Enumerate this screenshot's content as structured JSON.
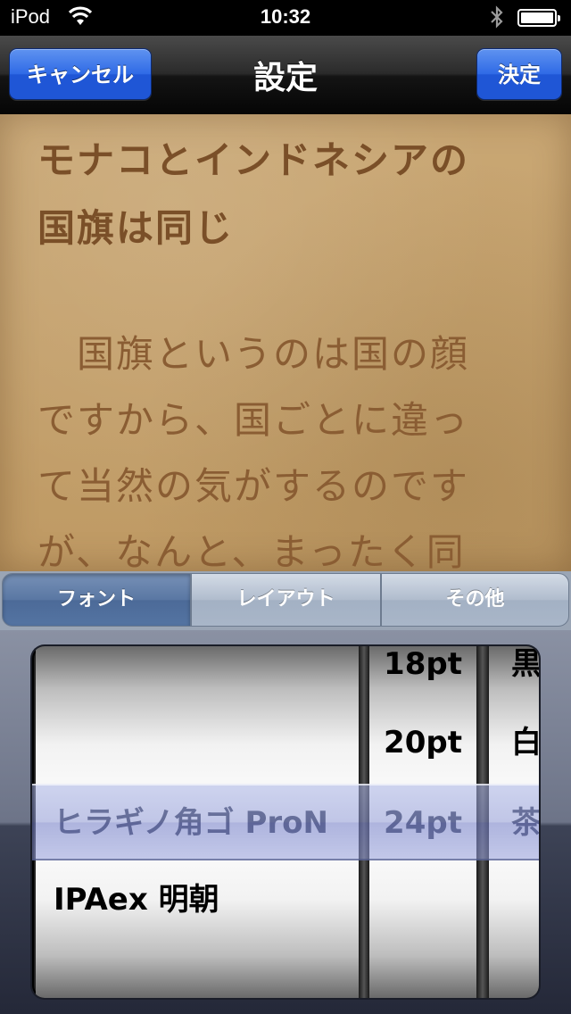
{
  "status": {
    "carrier": "iPod",
    "time": "10:32"
  },
  "nav": {
    "cancel_label": "キャンセル",
    "title": "設定",
    "done_label": "決定"
  },
  "preview": {
    "heading": [
      "モナコとインドネシアの",
      "国旗は同じ"
    ],
    "body": [
      "　国旗というのは国の顔",
      "ですから、国ごとに違っ",
      "て当然の気がするのです",
      "が、なんと、まったく同"
    ]
  },
  "tabs": [
    {
      "label": "フォント",
      "selected": true
    },
    {
      "label": "レイアウト",
      "selected": false
    },
    {
      "label": "その他",
      "selected": false
    }
  ],
  "picker": {
    "fonts": [
      "ヒラギノ角ゴ ProN",
      "IPAex 明朝"
    ],
    "sizes": [
      "18pt",
      "20pt",
      "24pt"
    ],
    "colors": [
      "黒",
      "白",
      "茶"
    ],
    "selected": {
      "font": "ヒラギノ角ゴ ProN",
      "size": "24pt",
      "color": "茶"
    }
  }
}
